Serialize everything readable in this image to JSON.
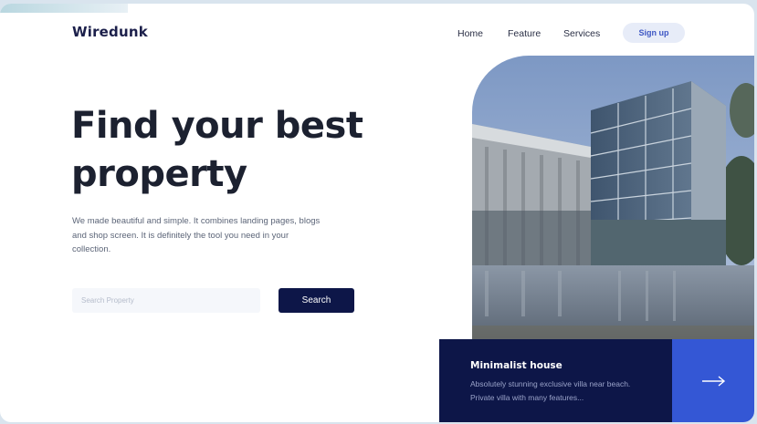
{
  "brand": {
    "name": "Wiredunk"
  },
  "nav": {
    "items": [
      {
        "label": "Home"
      },
      {
        "label": "Feature"
      },
      {
        "label": "Services"
      }
    ],
    "signup_label": "Sign up"
  },
  "hero": {
    "title": "Find your best property",
    "description": "We made beautiful and simple. It combines landing pages, blogs and shop screen. It is definitely the tool you need in your collection."
  },
  "search": {
    "placeholder": "Search Property",
    "value": "",
    "button_label": "Search"
  },
  "feature_card": {
    "title": "Minimalist house",
    "description": "Absolutely stunning exclusive villa near beach. Private villa with many features..."
  },
  "icons": {
    "hero_image": "building-photo",
    "card_action": "arrow-right-icon"
  },
  "colors": {
    "brand_dark": "#0d1648",
    "accent_blue": "#3457d5",
    "signup_bg": "#e7ecf8"
  }
}
